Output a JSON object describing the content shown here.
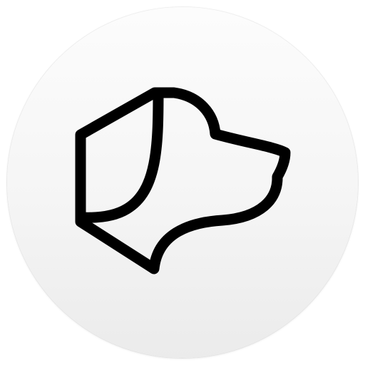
{
  "app_icon": {
    "icon": "dog-head-icon",
    "background_color": "#f5f5f5",
    "stroke_color": "#000000"
  }
}
